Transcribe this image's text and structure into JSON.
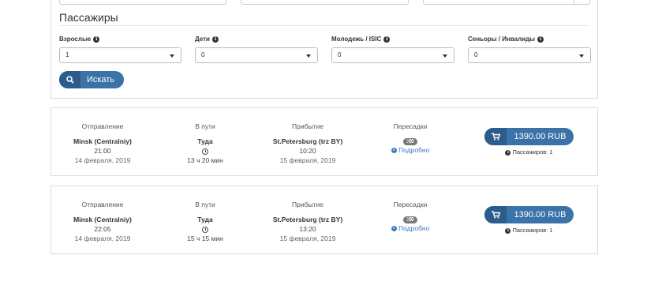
{
  "search": {
    "section_title": "Пассажиры",
    "fields": [
      {
        "label": "Взрослые",
        "value": "1"
      },
      {
        "label": "Дети",
        "value": "0"
      },
      {
        "label": "Молодежь / ISIC",
        "value": "0"
      },
      {
        "label": "Сеньоры / Инвалиды",
        "value": "0"
      }
    ],
    "search_button": "Искать"
  },
  "headers": {
    "departure": "Отправление",
    "duration": "В пути",
    "arrival": "Прибытие",
    "transfers": "Пересадки"
  },
  "results": [
    {
      "from": "Minsk (Centralniy)",
      "dep_time": "21:00",
      "dep_date": "14 февраля, 2019",
      "direction": "Туда",
      "duration": "13 ч 20 мин",
      "to": "St.Petersburg (trz BY)",
      "arr_time": "10:20",
      "arr_date": "15 февраля, 2019",
      "transfers": "0",
      "details": "Подробно",
      "price": "1390.00 RUB",
      "passengers": "Пассажиров: 1"
    },
    {
      "from": "Minsk (Centralniy)",
      "dep_time": "22:05",
      "dep_date": "14 февраля, 2019",
      "direction": "Туда",
      "duration": "15 ч 15 мин",
      "to": "St.Petersburg (trz BY)",
      "arr_time": "13:20",
      "arr_date": "15 февраля, 2019",
      "transfers": "0",
      "details": "Подробно",
      "price": "1390.00 RUB",
      "passengers": "Пассажиров: 1"
    }
  ],
  "colors": {
    "button": "#3b72a8",
    "button_icon_bg": "#2b5c8c",
    "link": "#3a7bbf"
  }
}
